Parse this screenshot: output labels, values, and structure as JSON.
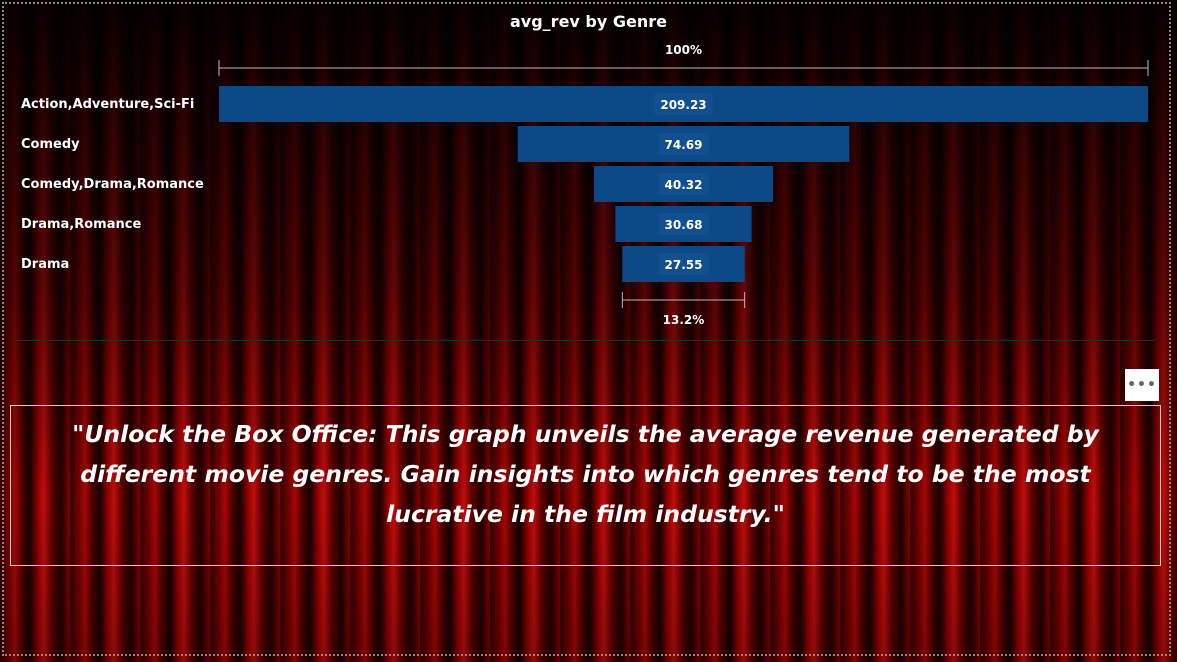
{
  "chart_data": {
    "type": "funnel",
    "title": "avg_rev by Genre",
    "categories": [
      "Action,Adventure,Sci-Fi",
      "Comedy",
      "Comedy,Drama,Romance",
      "Drama,Romance",
      "Drama"
    ],
    "values": [
      209.23,
      74.69,
      40.32,
      30.68,
      27.55
    ],
    "value_labels": [
      "209.23",
      "74.69",
      "40.32",
      "30.68",
      "27.55"
    ],
    "top_percent_label": "100%",
    "bottom_percent_label": "13.2%",
    "bar_color": "#0b4a86",
    "label_box_color": "#114f8f"
  },
  "description_text": "\"Unlock the Box Office: This graph unveils the average revenue generated by different movie genres. Gain insights into which genres tend to be the most lucrative in the film industry.\"",
  "menu": {
    "ellipsis": "•••"
  }
}
